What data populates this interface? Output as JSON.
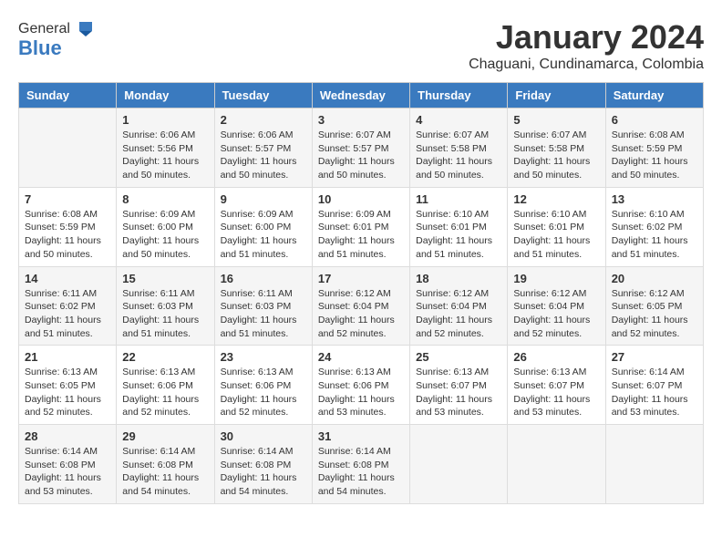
{
  "header": {
    "logo_general": "General",
    "logo_blue": "Blue",
    "month_title": "January 2024",
    "location": "Chaguani, Cundinamarca, Colombia"
  },
  "days_of_week": [
    "Sunday",
    "Monday",
    "Tuesday",
    "Wednesday",
    "Thursday",
    "Friday",
    "Saturday"
  ],
  "weeks": [
    [
      {
        "day": "",
        "info": ""
      },
      {
        "day": "1",
        "info": "Sunrise: 6:06 AM\nSunset: 5:56 PM\nDaylight: 11 hours\nand 50 minutes."
      },
      {
        "day": "2",
        "info": "Sunrise: 6:06 AM\nSunset: 5:57 PM\nDaylight: 11 hours\nand 50 minutes."
      },
      {
        "day": "3",
        "info": "Sunrise: 6:07 AM\nSunset: 5:57 PM\nDaylight: 11 hours\nand 50 minutes."
      },
      {
        "day": "4",
        "info": "Sunrise: 6:07 AM\nSunset: 5:58 PM\nDaylight: 11 hours\nand 50 minutes."
      },
      {
        "day": "5",
        "info": "Sunrise: 6:07 AM\nSunset: 5:58 PM\nDaylight: 11 hours\nand 50 minutes."
      },
      {
        "day": "6",
        "info": "Sunrise: 6:08 AM\nSunset: 5:59 PM\nDaylight: 11 hours\nand 50 minutes."
      }
    ],
    [
      {
        "day": "7",
        "info": "Sunrise: 6:08 AM\nSunset: 5:59 PM\nDaylight: 11 hours\nand 50 minutes."
      },
      {
        "day": "8",
        "info": "Sunrise: 6:09 AM\nSunset: 6:00 PM\nDaylight: 11 hours\nand 50 minutes."
      },
      {
        "day": "9",
        "info": "Sunrise: 6:09 AM\nSunset: 6:00 PM\nDaylight: 11 hours\nand 51 minutes."
      },
      {
        "day": "10",
        "info": "Sunrise: 6:09 AM\nSunset: 6:01 PM\nDaylight: 11 hours\nand 51 minutes."
      },
      {
        "day": "11",
        "info": "Sunrise: 6:10 AM\nSunset: 6:01 PM\nDaylight: 11 hours\nand 51 minutes."
      },
      {
        "day": "12",
        "info": "Sunrise: 6:10 AM\nSunset: 6:01 PM\nDaylight: 11 hours\nand 51 minutes."
      },
      {
        "day": "13",
        "info": "Sunrise: 6:10 AM\nSunset: 6:02 PM\nDaylight: 11 hours\nand 51 minutes."
      }
    ],
    [
      {
        "day": "14",
        "info": "Sunrise: 6:11 AM\nSunset: 6:02 PM\nDaylight: 11 hours\nand 51 minutes."
      },
      {
        "day": "15",
        "info": "Sunrise: 6:11 AM\nSunset: 6:03 PM\nDaylight: 11 hours\nand 51 minutes."
      },
      {
        "day": "16",
        "info": "Sunrise: 6:11 AM\nSunset: 6:03 PM\nDaylight: 11 hours\nand 51 minutes."
      },
      {
        "day": "17",
        "info": "Sunrise: 6:12 AM\nSunset: 6:04 PM\nDaylight: 11 hours\nand 52 minutes."
      },
      {
        "day": "18",
        "info": "Sunrise: 6:12 AM\nSunset: 6:04 PM\nDaylight: 11 hours\nand 52 minutes."
      },
      {
        "day": "19",
        "info": "Sunrise: 6:12 AM\nSunset: 6:04 PM\nDaylight: 11 hours\nand 52 minutes."
      },
      {
        "day": "20",
        "info": "Sunrise: 6:12 AM\nSunset: 6:05 PM\nDaylight: 11 hours\nand 52 minutes."
      }
    ],
    [
      {
        "day": "21",
        "info": "Sunrise: 6:13 AM\nSunset: 6:05 PM\nDaylight: 11 hours\nand 52 minutes."
      },
      {
        "day": "22",
        "info": "Sunrise: 6:13 AM\nSunset: 6:06 PM\nDaylight: 11 hours\nand 52 minutes."
      },
      {
        "day": "23",
        "info": "Sunrise: 6:13 AM\nSunset: 6:06 PM\nDaylight: 11 hours\nand 52 minutes."
      },
      {
        "day": "24",
        "info": "Sunrise: 6:13 AM\nSunset: 6:06 PM\nDaylight: 11 hours\nand 53 minutes."
      },
      {
        "day": "25",
        "info": "Sunrise: 6:13 AM\nSunset: 6:07 PM\nDaylight: 11 hours\nand 53 minutes."
      },
      {
        "day": "26",
        "info": "Sunrise: 6:13 AM\nSunset: 6:07 PM\nDaylight: 11 hours\nand 53 minutes."
      },
      {
        "day": "27",
        "info": "Sunrise: 6:14 AM\nSunset: 6:07 PM\nDaylight: 11 hours\nand 53 minutes."
      }
    ],
    [
      {
        "day": "28",
        "info": "Sunrise: 6:14 AM\nSunset: 6:08 PM\nDaylight: 11 hours\nand 53 minutes."
      },
      {
        "day": "29",
        "info": "Sunrise: 6:14 AM\nSunset: 6:08 PM\nDaylight: 11 hours\nand 54 minutes."
      },
      {
        "day": "30",
        "info": "Sunrise: 6:14 AM\nSunset: 6:08 PM\nDaylight: 11 hours\nand 54 minutes."
      },
      {
        "day": "31",
        "info": "Sunrise: 6:14 AM\nSunset: 6:08 PM\nDaylight: 11 hours\nand 54 minutes."
      },
      {
        "day": "",
        "info": ""
      },
      {
        "day": "",
        "info": ""
      },
      {
        "day": "",
        "info": ""
      }
    ]
  ]
}
